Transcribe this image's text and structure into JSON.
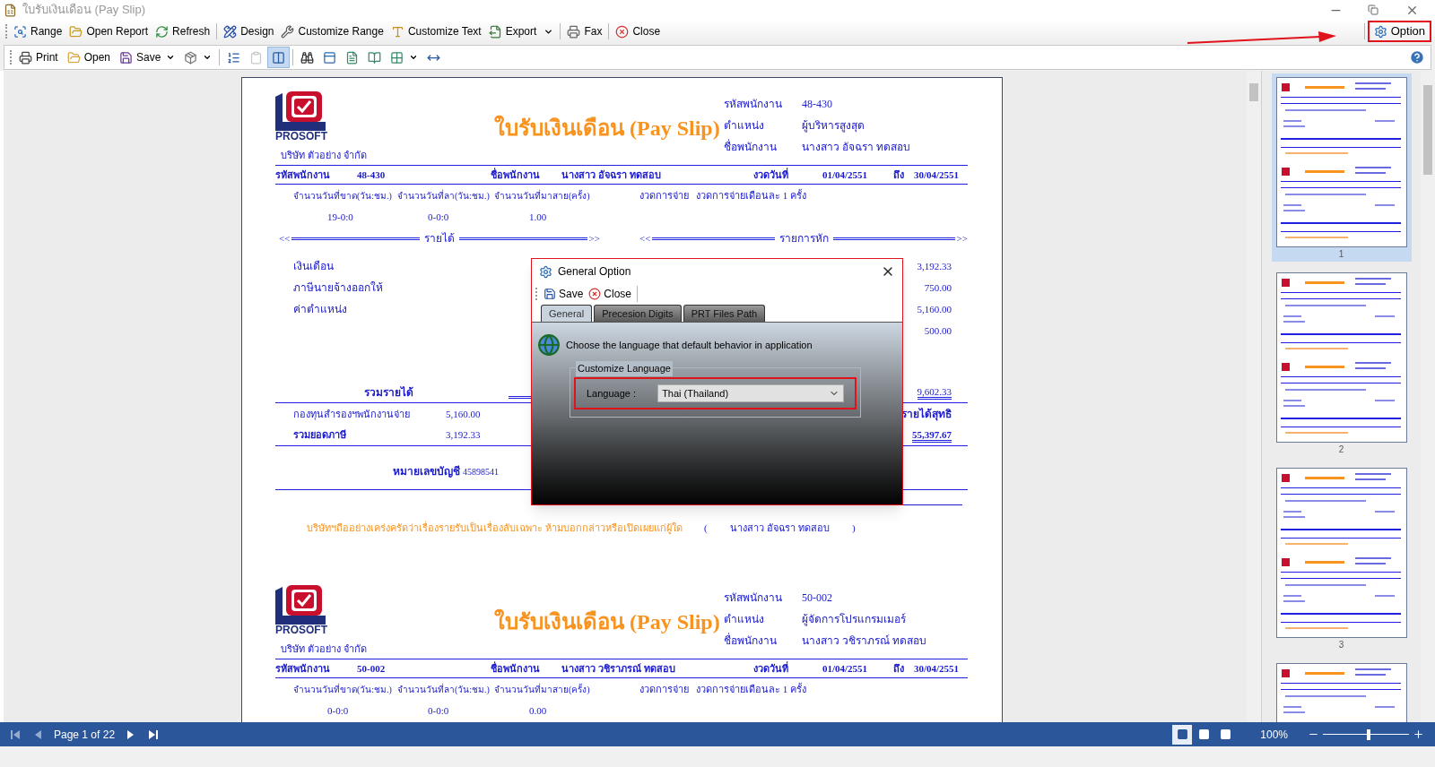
{
  "window": {
    "title": "ใบรับเงินเดือน (Pay Slip)"
  },
  "toolbar": [
    [
      {
        "label": "Range",
        "kind": "button"
      },
      {
        "label": "Open Report",
        "kind": "button"
      },
      {
        "label": "Refresh",
        "kind": "button"
      }
    ],
    [
      {
        "label": "Design",
        "kind": "button"
      },
      {
        "label": "Customize Range",
        "kind": "button"
      },
      {
        "label": "Customize Text",
        "kind": "button"
      },
      {
        "label": "Export",
        "kind": "menu"
      }
    ],
    [
      {
        "label": "Fax",
        "kind": "button"
      }
    ],
    [
      {
        "label": "Close",
        "kind": "button"
      }
    ]
  ],
  "option_button": {
    "label": "Option",
    "highlighted": true
  },
  "viewer_toolbar": [
    [
      {
        "label": "Print",
        "kind": "button",
        "selected": false,
        "disabled": false
      },
      {
        "label": "Open",
        "kind": "button",
        "selected": false,
        "disabled": false
      },
      {
        "label": "Save",
        "kind": "menu",
        "selected": false,
        "disabled": false
      },
      {
        "kind": "menu",
        "selected": false,
        "disabled": false
      }
    ],
    [
      {
        "kind": "button",
        "selected": false,
        "disabled": false
      },
      {
        "kind": "button",
        "selected": false,
        "disabled": true
      },
      {
        "kind": "button",
        "selected": true,
        "disabled": false
      }
    ],
    [
      {
        "kind": "button",
        "selected": false,
        "disabled": false
      },
      {
        "kind": "button",
        "selected": false,
        "disabled": false
      },
      {
        "kind": "button",
        "selected": false,
        "disabled": false
      },
      {
        "kind": "button",
        "selected": false,
        "disabled": false
      },
      {
        "kind": "menu",
        "selected": false,
        "disabled": false
      },
      {
        "kind": "button",
        "selected": false,
        "disabled": false
      }
    ]
  ],
  "slips": [
    {
      "logo_text": "PROSOFT",
      "company": "บริษัท ตัวอย่าง จำกัด",
      "title": "ใบรับเงินเดือน (Pay Slip)",
      "info": [
        {
          "label": "รหัสพนักงาน",
          "value": "48-430"
        },
        {
          "label": "ตำแหน่ง",
          "value": "ผู้บริหารสูงสุด"
        },
        {
          "label": "ชื่อพนักงาน",
          "value": "นางสาว อัจฉรา ทดสอบ"
        }
      ],
      "summary": [
        "รหัสพนักงาน",
        "48-430",
        "ชื่อพนักงาน",
        "นางสาว อัจฉรา ทดสอบ",
        "งวดวันที่",
        "01/04/2551",
        "ถึง",
        "30/04/2551"
      ],
      "attendance_headers": [
        "จำนวนวันที่ขาด(วัน:ชม.)",
        "จำนวนวันที่ลา(วัน:ชม.)",
        "จำนวนวันที่มาสาย(ครั้ง)"
      ],
      "payment_label": "งวดการจ่าย",
      "payment_value": "งวดการจ่ายเดือนละ 1 ครั้ง",
      "attendance_values": [
        "19-0:0",
        "0-0:0",
        "1.00"
      ],
      "income_header": {
        "open": "<<",
        "label": "รายได้",
        "close": ">>"
      },
      "deduction_header": {
        "open": "<<",
        "label": "รายการหัก",
        "close": ">>"
      },
      "income_items": [
        "เงินเดือน",
        "ภาษีนายจ้างออกให้",
        "ค่าตำแหน่ง"
      ],
      "deduction_values": [
        "3,192.33",
        "750.00",
        "5,160.00",
        "500.00"
      ],
      "total_income_label": "รวมรายได้",
      "total_value": "9,602.33",
      "fund_label": "กองทุนสำรองฯพนักงานจ่าย",
      "fund_value": "5,160.00",
      "net_label": "รายได้สุทธิ",
      "tax_label": "รวมยอดภาษี",
      "tax_value": "3,192.33",
      "net_value": "55,397.67",
      "account_label": "หมายเลขบัญชี",
      "account_value": "45898541",
      "notice": "บริษัทฯถืออย่างเคร่งครัดว่าเรื่องรายรับเป็นเรื่องลับเฉพาะ ห้ามบอกกล่าวหรือเปิดเผยแก่ผู้ใด",
      "signer_open": "(",
      "signer": "นางสาว อัจฉรา ทดสอบ",
      "signer_close": ")"
    },
    {
      "logo_text": "PROSOFT",
      "company": "บริษัท ตัวอย่าง จำกัด",
      "title": "ใบรับเงินเดือน (Pay Slip)",
      "info": [
        {
          "label": "รหัสพนักงาน",
          "value": "50-002"
        },
        {
          "label": "ตำแหน่ง",
          "value": "ผู้จัดการโปรแกรมเมอร์"
        },
        {
          "label": "ชื่อพนักงาน",
          "value": "นางสาว วชิราภรณ์ ทดสอบ"
        }
      ],
      "summary": [
        "รหัสพนักงาน",
        "50-002",
        "ชื่อพนักงาน",
        "นางสาว วชิราภรณ์ ทดสอบ",
        "งวดวันที่",
        "01/04/2551",
        "ถึง",
        "30/04/2551"
      ],
      "attendance_headers": [
        "จำนวนวันที่ขาด(วัน:ชม.)",
        "จำนวนวันที่ลา(วัน:ชม.)",
        "จำนวนวันที่มาสาย(ครั้ง)"
      ],
      "payment_label": "งวดการจ่าย",
      "payment_value": "งวดการจ่ายเดือนละ 1 ครั้ง",
      "attendance_values": [
        "0-0:0",
        "0-0:0",
        "0.00"
      ]
    }
  ],
  "dialog": {
    "title": "General Option",
    "toolbar": [
      {
        "label": "Save"
      },
      {
        "label": "Close"
      }
    ],
    "tabs": [
      {
        "label": "General",
        "selected": true
      },
      {
        "label": "Precesion Digits",
        "selected": false
      },
      {
        "label": "PRT Files Path",
        "selected": false
      }
    ],
    "description": "Choose the language that default behavior in application",
    "group_title": "Customize Language",
    "field_label": "Language :",
    "field_value": "Thai (Thailand)",
    "highlighted": true
  },
  "thumbnails": [
    {
      "label": "1",
      "selected": true
    },
    {
      "label": "2",
      "selected": false
    },
    {
      "label": "3",
      "selected": false
    },
    {
      "selected": false
    }
  ],
  "status_bar": {
    "nav": [
      {
        "disabled": true
      },
      {
        "disabled": true
      },
      {
        "disabled": false
      },
      {
        "disabled": false
      }
    ],
    "page": "Page 1 of 22",
    "view_modes": [
      {
        "selected": true
      },
      {
        "selected": false
      },
      {
        "selected": false
      }
    ],
    "zoom": "100%",
    "zoom_slider": {
      "level": 0.53
    }
  }
}
